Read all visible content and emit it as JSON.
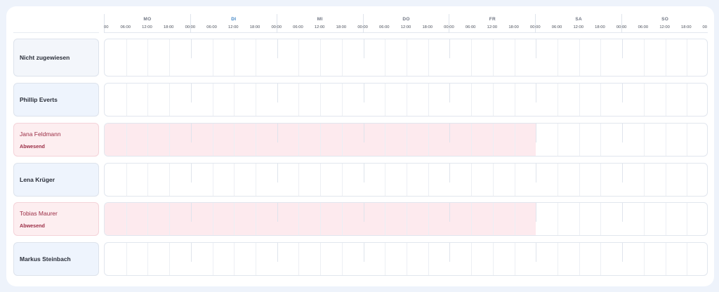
{
  "schedule": {
    "days": [
      {
        "label": "MO",
        "active": false
      },
      {
        "label": "DI",
        "active": true
      },
      {
        "label": "MI",
        "active": false
      },
      {
        "label": "DO",
        "active": false
      },
      {
        "label": "FR",
        "active": false
      },
      {
        "label": "SA",
        "active": false
      },
      {
        "label": "SO",
        "active": false
      }
    ],
    "hours": [
      "00",
      "06:00",
      "12:00",
      "18:00",
      "00:00",
      "06:00",
      "12:00",
      "18:00",
      "00:00",
      "06:00",
      "12:00",
      "18:00",
      "00:00",
      "06:00",
      "12:00",
      "18:00",
      "00:00",
      "06:00",
      "12:00",
      "18:00",
      "00:00",
      "06:00",
      "12:00",
      "18:00",
      "00:00",
      "06:00",
      "12:00",
      "18:00",
      "00"
    ],
    "rows": [
      {
        "name": "Nicht zugewiesen",
        "status": "",
        "variant": "gray",
        "absent_days": 0
      },
      {
        "name": "Phillip Everts",
        "status": "",
        "variant": "blue",
        "absent_days": 0
      },
      {
        "name": "Jana Feldmann",
        "status": "Abwesend",
        "variant": "absent",
        "absent_days": 5
      },
      {
        "name": "Lena Krüger",
        "status": "",
        "variant": "blue",
        "absent_days": 0
      },
      {
        "name": "Tobias Maurer",
        "status": "Abwesend",
        "variant": "absent",
        "absent_days": 5
      },
      {
        "name": "Markus Steinbach",
        "status": "",
        "variant": "blue",
        "absent_days": 0
      }
    ]
  }
}
